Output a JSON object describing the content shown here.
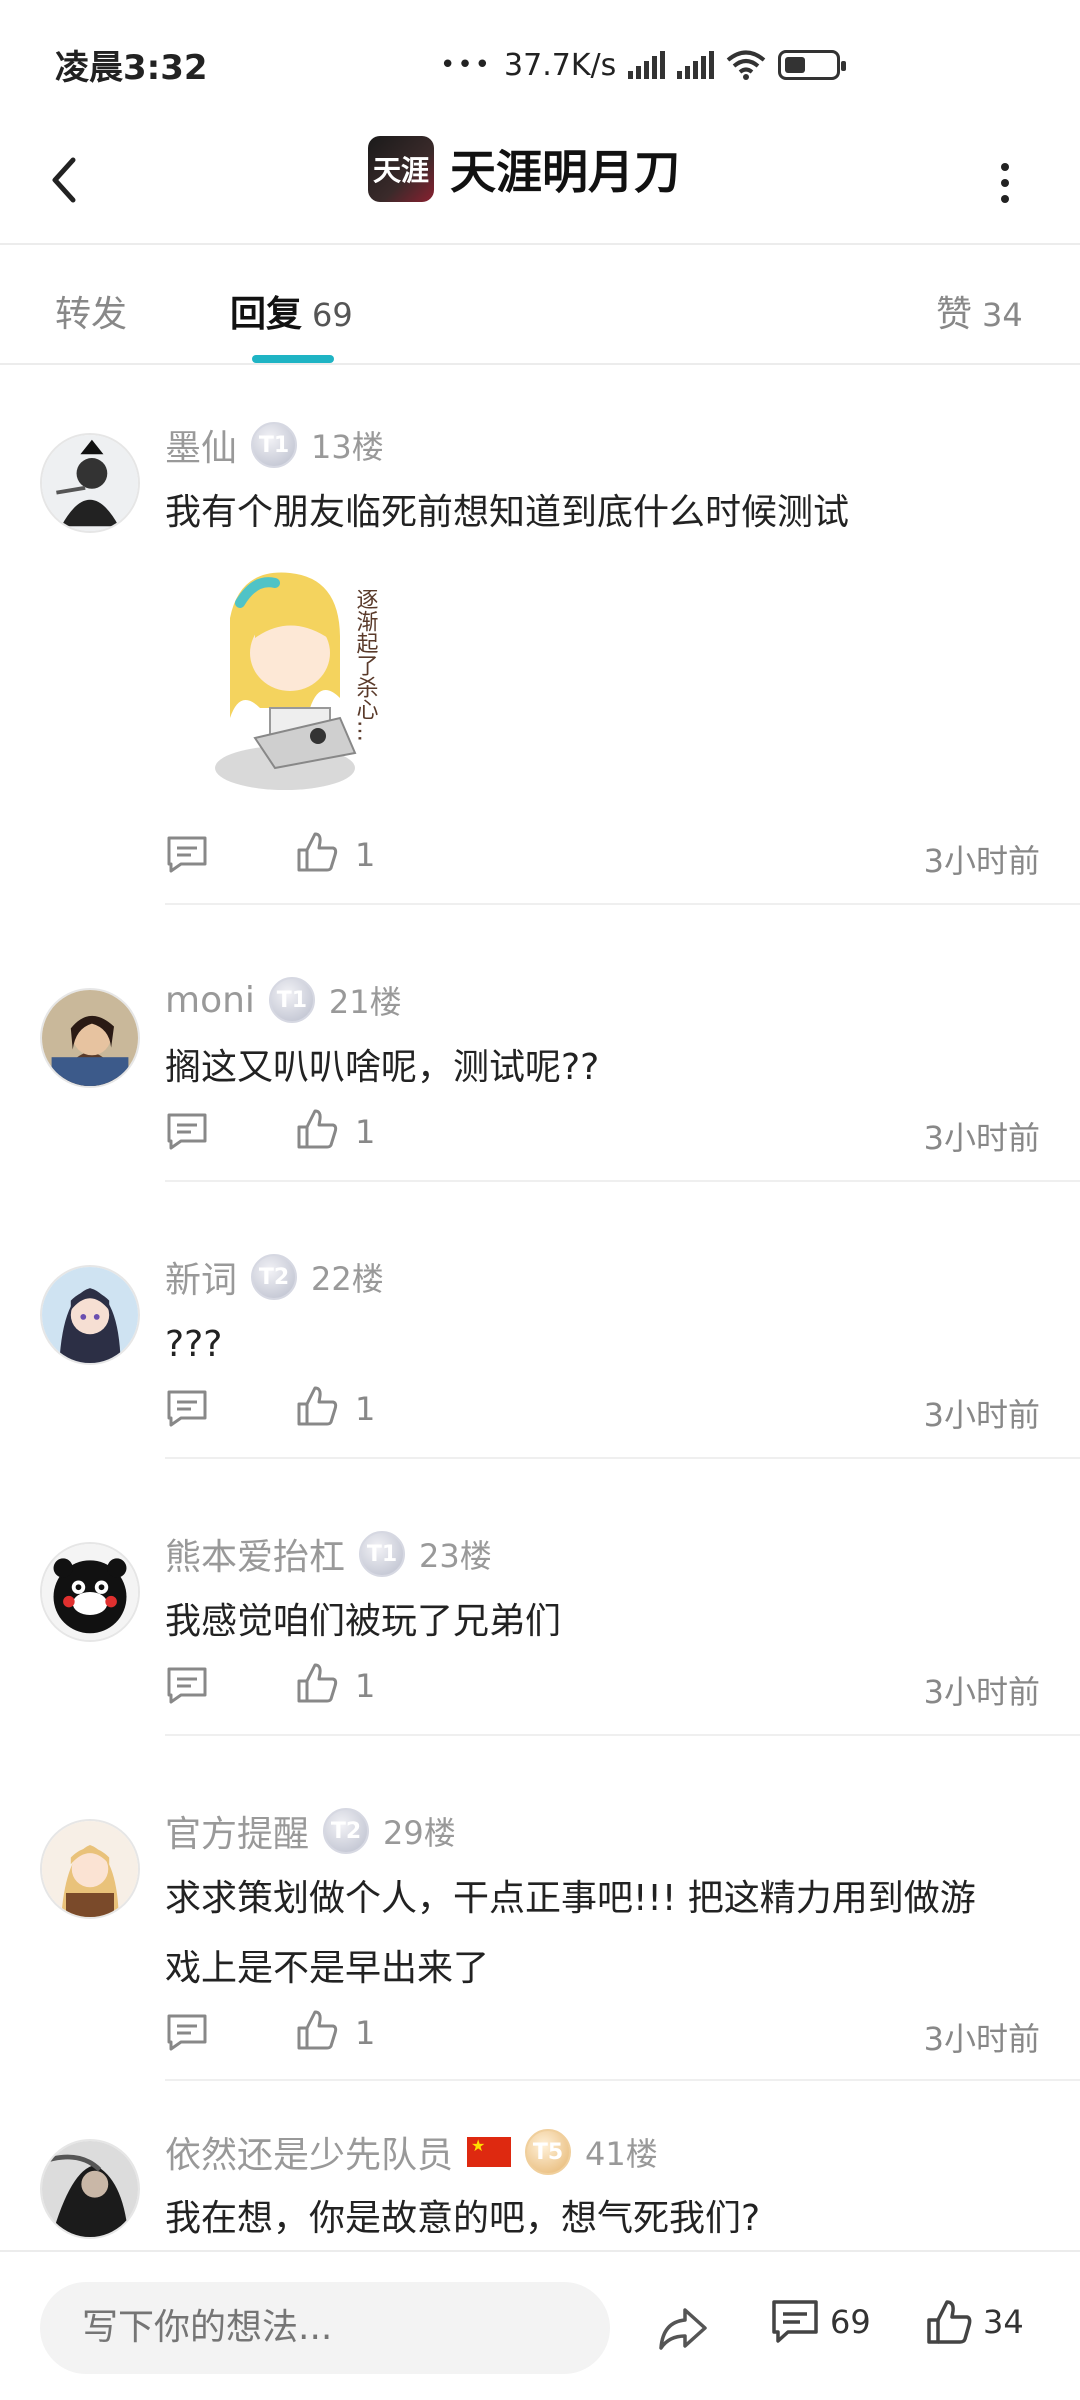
{
  "status_bar": {
    "time": "凌晨3:32",
    "network_speed": "37.7K/s"
  },
  "header": {
    "title": "天涯明月刀",
    "logo_text": "天涯"
  },
  "tabs": {
    "forward_label": "转发",
    "reply_label": "回复",
    "reply_count": "69",
    "likes_label": "赞",
    "likes_count": "34"
  },
  "comments": [
    {
      "username": "墨仙",
      "level": "T1",
      "floor": "13楼",
      "text": "我有个朋友临死前想知道到底什么时候测试",
      "sticker_text": "逐渐起了杀心…",
      "likes": "1",
      "time": "3小时前"
    },
    {
      "username": "moni",
      "level": "T1",
      "floor": "21楼",
      "text": "搁这又叭叭啥呢，测试呢??",
      "likes": "1",
      "time": "3小时前"
    },
    {
      "username": "新词",
      "level": "T2",
      "floor": "22楼",
      "text": "???",
      "likes": "1",
      "time": "3小时前"
    },
    {
      "username": "熊本爱抬杠",
      "level": "T1",
      "floor": "23楼",
      "text": "我感觉咱们被玩了兄弟们",
      "likes": "1",
      "time": "3小时前"
    },
    {
      "username": "官方提醒",
      "level": "T2",
      "floor": "29楼",
      "text_line1": "求求策划做个人，干点正事吧!!! 把这精力用到做游",
      "text_line2": "戏上是不是早出来了",
      "likes": "1",
      "time": "3小时前"
    },
    {
      "username": "依然还是少先队员",
      "level": "T5",
      "floor": "41楼",
      "text": "我在想，你是故意的吧，想气死我们?"
    }
  ],
  "bottom_bar": {
    "input_placeholder": "写下你的想法...",
    "comment_count": "69",
    "like_count": "34"
  },
  "colors": {
    "accent": "#1fb4c4",
    "text_primary": "#222222",
    "text_secondary": "#999999"
  },
  "icons": [
    "back-arrow-icon",
    "more-icon",
    "reply-icon",
    "like-icon",
    "share-icon",
    "comment-icon",
    "china-flag-icon"
  ]
}
